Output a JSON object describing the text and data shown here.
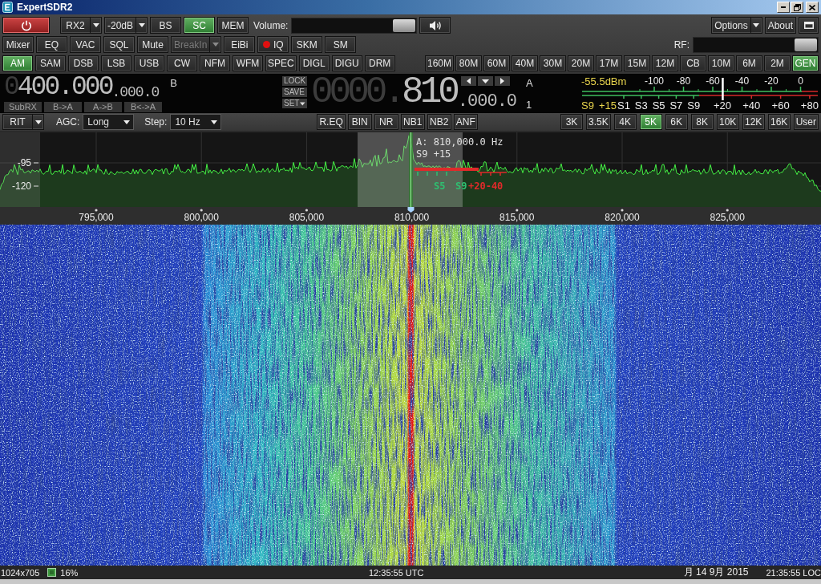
{
  "window": {
    "title": "ExpertSDR2"
  },
  "toolbar_row_1": {
    "left": [
      {
        "kind": "power"
      },
      {
        "kind": "dropdown",
        "label": "RX2",
        "disabled": false
      },
      {
        "kind": "dropdown",
        "label": "-20dB",
        "disabled": false
      },
      {
        "kind": "toggle",
        "label": "BS",
        "selected": false
      },
      {
        "kind": "toggle",
        "label": "SC",
        "selected": true
      },
      {
        "kind": "toggle",
        "label": "MEM",
        "selected": false
      },
      {
        "kind": "label",
        "label": "Volume:"
      },
      {
        "kind": "slider",
        "level": 1
      },
      {
        "kind": "speaker"
      }
    ],
    "right": [
      {
        "kind": "dropdown",
        "label": "Options",
        "disabled": false
      },
      {
        "kind": "button",
        "label": "About"
      },
      {
        "kind": "window"
      }
    ]
  },
  "toolbar_row_2": {
    "left": [
      {
        "kind": "toggle",
        "label": "Mixer",
        "selected": false
      },
      {
        "kind": "toggle",
        "label": "EQ",
        "selected": false
      },
      {
        "kind": "toggle",
        "label": "VAC",
        "selected": false
      },
      {
        "kind": "toggle",
        "label": "SQL",
        "selected": false
      },
      {
        "kind": "toggle",
        "label": "Mute",
        "selected": false
      },
      {
        "kind": "dropdown",
        "label": "BreakIn",
        "disabled": true
      },
      {
        "kind": "toggle",
        "label": "EiBi",
        "selected": false
      },
      {
        "kind": "record",
        "label": "IQ",
        "selected": false
      },
      {
        "kind": "toggle",
        "label": "SKM",
        "selected": false
      },
      {
        "kind": "toggle",
        "label": "SM",
        "selected": false
      }
    ],
    "right": [
      {
        "kind": "label",
        "label": "RF:"
      },
      {
        "kind": "slider",
        "level": 1
      }
    ]
  },
  "modes": [
    {
      "label": "AM",
      "selected": true
    },
    {
      "label": "SAM",
      "selected": false
    },
    {
      "label": "DSB",
      "selected": false
    },
    {
      "label": "LSB",
      "selected": false
    },
    {
      "label": "USB",
      "selected": false
    },
    {
      "label": "CW",
      "selected": false
    },
    {
      "label": "NFM",
      "selected": false
    },
    {
      "label": "WFM",
      "selected": false
    },
    {
      "label": "SPEC",
      "selected": false
    },
    {
      "label": "DIGL",
      "selected": false
    },
    {
      "label": "DIGU",
      "selected": false
    },
    {
      "label": "DRM",
      "selected": false
    }
  ],
  "bands": [
    {
      "label": "160M",
      "selected": false
    },
    {
      "label": "80M",
      "selected": false
    },
    {
      "label": "60M",
      "selected": false
    },
    {
      "label": "40M",
      "selected": false
    },
    {
      "label": "30M",
      "selected": false
    },
    {
      "label": "20M",
      "selected": false
    },
    {
      "label": "17M",
      "selected": false
    },
    {
      "label": "15M",
      "selected": false
    },
    {
      "label": "12M",
      "selected": false
    },
    {
      "label": "CB",
      "selected": false
    },
    {
      "label": "10M",
      "selected": false
    },
    {
      "label": "6M",
      "selected": false
    },
    {
      "label": "2M",
      "selected": false
    },
    {
      "label": "GEN",
      "selected": true
    }
  ],
  "vfo_b": {
    "leading_digits": "0",
    "digits": "400.000",
    "fine_digits": ".000.0",
    "label": "B",
    "buttons": [
      "SubRX",
      "B->A",
      "A->B",
      "B<->A"
    ]
  },
  "memory_buttons": [
    {
      "kind": "button",
      "label": "LOCK"
    },
    {
      "kind": "button",
      "label": "SAVE"
    },
    {
      "kind": "dropdown",
      "label": "SET"
    }
  ],
  "vfo_a": {
    "leading_digits": "0000.",
    "digits": "810",
    "fine_digits": ".000.0",
    "label": "A",
    "receiver": "1"
  },
  "s_meter": {
    "reading": "-55.5dBm",
    "dbm_scale": [
      "-100",
      "-80",
      "-60",
      "-40",
      "-20",
      "0"
    ],
    "signal": "S9",
    "over": "+15",
    "s_scale": [
      "S1",
      "S3",
      "S5",
      "S7",
      "S9",
      "+20",
      "+40",
      "+60",
      "+80"
    ],
    "level": 0.6
  },
  "controls": {
    "rit": {
      "label": "RIT"
    },
    "agc": {
      "label": "AGC:",
      "value": "Long"
    },
    "step": {
      "label": "Step:",
      "value": "10 Hz"
    }
  },
  "dsp_buttons": [
    {
      "label": "R.EQ",
      "selected": false
    },
    {
      "label": "BIN",
      "selected": false
    },
    {
      "label": "NR",
      "selected": false
    },
    {
      "label": "NB1",
      "selected": false
    },
    {
      "label": "NB2",
      "selected": false
    },
    {
      "label": "ANF",
      "selected": false
    }
  ],
  "filters": [
    {
      "label": "3K",
      "selected": false
    },
    {
      "label": "3.5K",
      "selected": false
    },
    {
      "label": "4K",
      "selected": false
    },
    {
      "label": "5K",
      "selected": true
    },
    {
      "label": "6K",
      "selected": false
    },
    {
      "label": "8K",
      "selected": false
    },
    {
      "label": "10K",
      "selected": false
    },
    {
      "label": "12K",
      "selected": false
    },
    {
      "label": "16K",
      "selected": false
    },
    {
      "label": "User",
      "selected": false
    }
  ],
  "spectrum": {
    "y_labels": [
      "-95",
      "-120"
    ],
    "readout": "A: 810,000.0 Hz",
    "signal": "S9 +15",
    "meter_labels": [
      {
        "kind": "s",
        "text": "S5"
      },
      {
        "kind": "s",
        "text": "S9"
      },
      {
        "kind": "over",
        "text": "+20-40"
      }
    ],
    "x_labels": [
      "795,000",
      "800,000",
      "805,000",
      "810,000",
      "815,000",
      "820,000",
      "825,000"
    ]
  },
  "status_bar": {
    "resolution": "1024x705",
    "cpu": "16%",
    "utc": "12:35:55 UTC",
    "date": "月 14 9月 2015",
    "local": "21:35:55 LOC"
  }
}
